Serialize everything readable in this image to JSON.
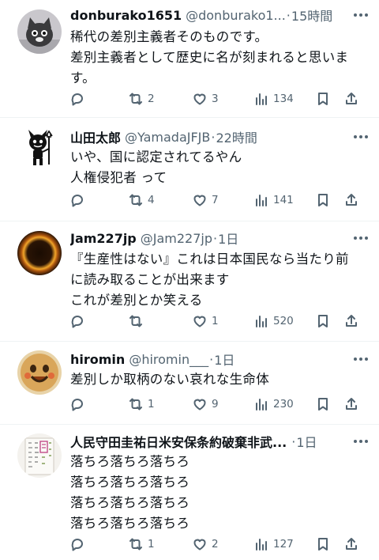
{
  "tweets": [
    {
      "name": "donburako1651",
      "handle": "@donburako1...",
      "time": "15時間",
      "avatar": "gray-cat-avatar",
      "lines": [
        "稀代の差別主義者そのものです。",
        "差別主義者として歴史に名が刻まれると思いま",
        "す。"
      ],
      "replies": "",
      "retweets": "2",
      "likes": "3",
      "views": "134"
    },
    {
      "name": "山田太郎",
      "handle": "@YamadaJFJB",
      "time": "22時間",
      "avatar": "black-devil-avatar",
      "lines": [
        "いや、国に認定されてるやん",
        "人権侵犯者 って"
      ],
      "replies": "",
      "retweets": "4",
      "likes": "7",
      "views": "141"
    },
    {
      "name": "Jam227jp",
      "handle": "@Jam227jp",
      "time": "1日",
      "avatar": "fire-ring-avatar",
      "lines": [
        "『生産性はない』これは日本国民なら当たり前",
        "に読み取ることが出来ます",
        "これが差別とか笑える"
      ],
      "replies": "",
      "retweets": "",
      "likes": "1",
      "views": "520"
    },
    {
      "name": "hiromin",
      "handle": "@hiromin___",
      "time": "1日",
      "avatar": "smiley-cookie-avatar",
      "lines": [
        "差別しか取柄のない哀れな生命体"
      ],
      "replies": "",
      "retweets": "1",
      "likes": "9",
      "views": "230"
    },
    {
      "name": "人民守田圭祐日米安保条約破棄非武...",
      "handle": "",
      "time": "1日",
      "avatar": "handwritten-paper-avatar",
      "lines": [
        "落ちろ落ちろ落ちろ",
        "落ちろ落ちろ落ちろ",
        "落ちろ落ちろ落ちろ",
        "落ちろ落ちろ落ちろ"
      ],
      "replies": "",
      "retweets": "1",
      "likes": "2",
      "views": "127"
    }
  ],
  "dot_separator": "·",
  "colors": {
    "text": "#0f1419",
    "secondary": "#536471",
    "divider": "#eff3f4"
  }
}
